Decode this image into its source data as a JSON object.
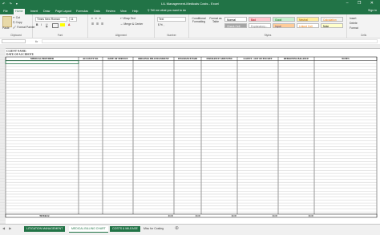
{
  "window": {
    "title": "LIL Management-Medicals Costs - Excel",
    "quick_access": "↶ ↷ ▾",
    "controls": "– ❐ ✕"
  },
  "ribbon_tabs": [
    "File",
    "Home",
    "Insert",
    "Draw",
    "Page Layout",
    "Formulas",
    "Data",
    "Review",
    "View",
    "Help"
  ],
  "tell_me": "Tell me what you want to do",
  "user": "Sign in",
  "clipboard": {
    "paste": "Paste",
    "cut": "Cut",
    "copy": "Copy",
    "format_painter": "Format Painter",
    "label": "Clipboard"
  },
  "font": {
    "name": "Times New Roman",
    "size": "11",
    "bold": "B",
    "italic": "I",
    "underline": "U",
    "label": "Font"
  },
  "alignment": {
    "wrap": "Wrap Text",
    "merge": "Merge & Center",
    "label": "Alignment"
  },
  "number": {
    "format": "Text",
    "currency": "$ % ,",
    "label": "Number"
  },
  "styles": {
    "conditional": "Conditional Formatting",
    "format_as_table": "Format as Table",
    "label": "Styles",
    "cells": [
      {
        "name": "Normal",
        "bg": "#ffffff",
        "fg": "#000000"
      },
      {
        "name": "Bad",
        "bg": "#ffc7ce",
        "fg": "#9c0006"
      },
      {
        "name": "Good",
        "bg": "#c6efce",
        "fg": "#006100"
      },
      {
        "name": "Neutral",
        "bg": "#ffeb9c",
        "fg": "#9c5700"
      },
      {
        "name": "Calculation",
        "bg": "#f2f2f2",
        "fg": "#fa7d00"
      },
      {
        "name": "Check Cell",
        "bg": "#a5a5a5",
        "fg": "#ffffff"
      },
      {
        "name": "Explanatory...",
        "bg": "#ffffff",
        "fg": "#7f7f7f"
      },
      {
        "name": "Input",
        "bg": "#ffcc99",
        "fg": "#3f3f76"
      },
      {
        "name": "Linked Cell",
        "bg": "#ffffff",
        "fg": "#fa7d00"
      },
      {
        "name": "Note",
        "bg": "#ffffcc",
        "fg": "#000000"
      }
    ]
  },
  "cells_group": {
    "insert": "Insert",
    "delete": "Delete",
    "format": "Format",
    "label": "Cells"
  },
  "formula_bar": {
    "name_box": "",
    "fx": "fx"
  },
  "sheet": {
    "client_name": "CLIENT NAME:",
    "date_of_accident": "DATE OF ACCIDENT:",
    "headers": [
      "MEDICAL PROVIDER",
      "ACCOUNT NO.",
      "DATE OF SERVICE",
      "ORIGINAL BILLED AMOUNT",
      "INSURANCE PAID",
      "INSURANCE ADJUSTED",
      "CLIENT - OUT OF POCKET",
      "REMAINING BALANCE",
      "NOTES"
    ],
    "totals_label": "TOTALS:",
    "totals": [
      "$0.00",
      "$0.00",
      "$0.00",
      "$0.00",
      "$0.00"
    ]
  },
  "sheet_tabs": [
    {
      "label": "LITIGATION MANAGEMENT",
      "state": "green"
    },
    {
      "label": "MEDICAL BILLING CHART",
      "state": "selected"
    },
    {
      "label": "COSTS & MILEAGE",
      "state": "green"
    },
    {
      "label": "Misc for Costing",
      "state": "plain"
    }
  ]
}
